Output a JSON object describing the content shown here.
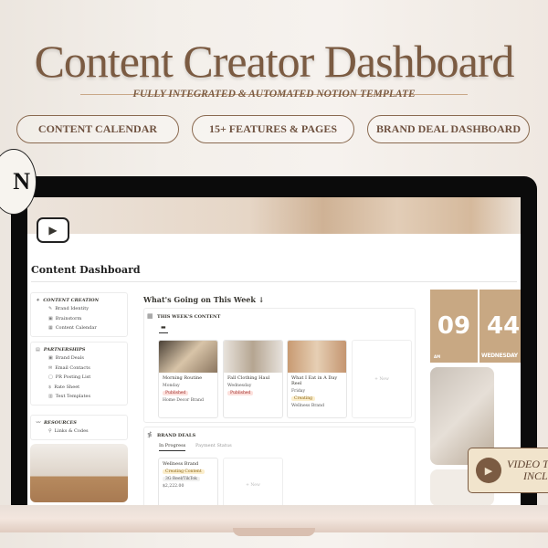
{
  "banner": {
    "title": "Content Creator Dashboard",
    "subtitle": "FULLY INTEGRATED & AUTOMATED NOTION TEMPLATE",
    "pills": [
      "CONTENT CALENDAR",
      "15+ FEATURES & PAGES",
      "BRAND DEAL DASHBOARD"
    ],
    "notion_logo": "N",
    "video_badge": [
      "VIDEO T",
      "INCL"
    ]
  },
  "page": {
    "title": "Content Dashboard",
    "heading": "What's Going on This Week ↓"
  },
  "sidebar": [
    {
      "title": "CONTENT CREATION",
      "items": [
        "Brand Identity",
        "Brainstorm",
        "Content Calendar"
      ]
    },
    {
      "title": "PARTNERSHIPS",
      "items": [
        "Brand Deals",
        "Email Contacts",
        "PR Posting List",
        "Rate Sheet",
        "Text Templates"
      ]
    },
    {
      "title": "RESOURCES",
      "items": [
        "Links & Codes"
      ]
    }
  ],
  "week": {
    "title": "THIS WEEK'S CONTENT",
    "new_label": "+ New",
    "cards": [
      {
        "title": "Morning Routine",
        "day": "Monday",
        "status": "Published",
        "brand": "Home Decor Brand"
      },
      {
        "title": "Fall Clothing Haul",
        "day": "Wednesday",
        "status": "Published",
        "brand": ""
      },
      {
        "title": "What I Eat in A Day Reel",
        "day": "Friday",
        "status": "Creating",
        "brand": "Wellness Brand"
      }
    ]
  },
  "deals": {
    "title": "BRAND DEALS",
    "tabs": [
      "In Progress",
      "Payment Status"
    ],
    "new_label": "+ New",
    "card": {
      "brand": "Wellness Brand",
      "status": "Creating Content",
      "type": "3G Reel/TikTok",
      "amount": "$2,222.00"
    }
  },
  "clock": {
    "hour": "09",
    "minute": "44",
    "ampm": "AM",
    "day": "WEDNESDAY"
  },
  "colors": {
    "accent": "#7b5b42",
    "clock": "#c8a883",
    "published": "#fde1dd",
    "creating": "#fbeecc"
  }
}
